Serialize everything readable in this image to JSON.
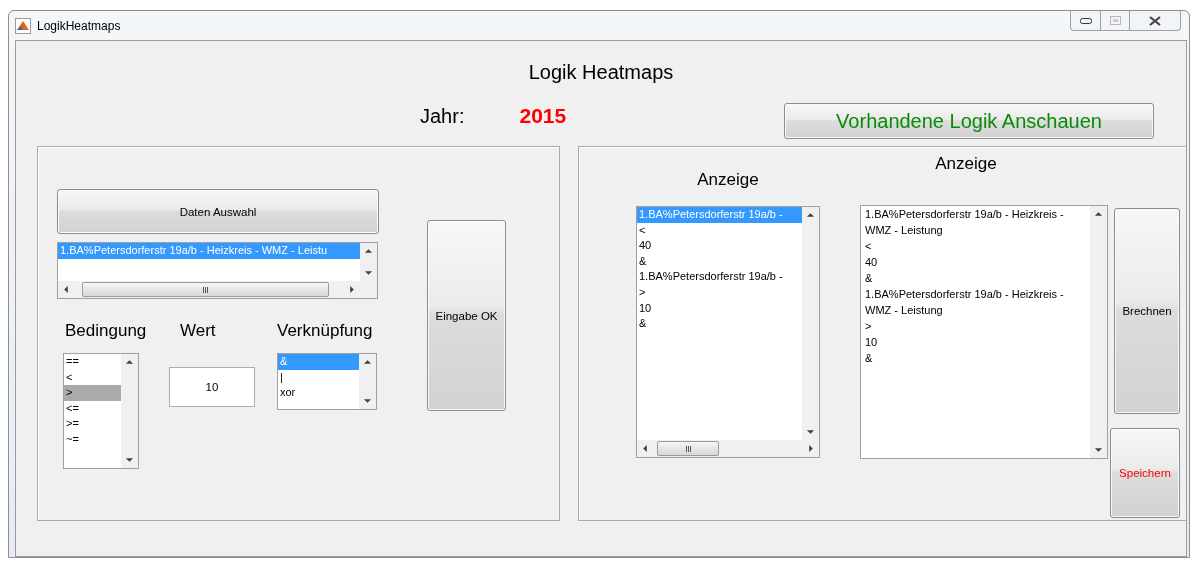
{
  "window": {
    "title": "LogikHeatmaps"
  },
  "heading": "Logik Heatmaps",
  "year_label": "Jahr:",
  "year": "2015",
  "show_button": "Vorhandene Logik Anschauen",
  "left_panel": {
    "data_button": "Daten Auswahl",
    "data_list": {
      "focused": true,
      "items": [
        {
          "text": "1.BA%Petersdorferstr 19a/b - Heizkreis - WMZ - Leistu",
          "selected": true
        }
      ]
    },
    "condition": {
      "label": "Bedingung",
      "focused": false,
      "items": [
        {
          "text": "==",
          "selected": false
        },
        {
          "text": "<",
          "selected": false
        },
        {
          "text": ">",
          "selected": true
        },
        {
          "text": "<=",
          "selected": false
        },
        {
          "text": ">=",
          "selected": false
        },
        {
          "text": "~=",
          "selected": false
        }
      ]
    },
    "value": {
      "label": "Wert",
      "value": "10"
    },
    "link": {
      "label": "Verknüpfung",
      "focused": true,
      "items": [
        {
          "text": "&",
          "selected": true
        },
        {
          "text": "|",
          "selected": false
        },
        {
          "text": "xor",
          "selected": false
        }
      ]
    },
    "ok_button": "Eingabe OK"
  },
  "right_panel": {
    "title": "Anzeige",
    "list_title": "Anzeige",
    "list": {
      "focused": true,
      "items": [
        {
          "text": "1.BA%Petersdorferstr 19a/b -",
          "selected": true
        },
        {
          "text": "<",
          "selected": false
        },
        {
          "text": "40",
          "selected": false
        },
        {
          "text": "&",
          "selected": false
        },
        {
          "text": "1.BA%Petersdorferstr 19a/b -",
          "selected": false
        },
        {
          "text": ">",
          "selected": false
        },
        {
          "text": "10",
          "selected": false
        },
        {
          "text": "&",
          "selected": false
        }
      ]
    },
    "output_list": {
      "items": [
        {
          "text": "1.BA%Petersdorferstr 19a/b - Heizkreis - WMZ - Leistung",
          "selected": false
        },
        {
          "text": "<",
          "selected": false
        },
        {
          "text": "40",
          "selected": false
        },
        {
          "text": "&",
          "selected": false
        },
        {
          "text": "1.BA%Petersdorferstr 19a/b - Heizkreis - WMZ - Leistung",
          "selected": false
        },
        {
          "text": ">",
          "selected": false
        },
        {
          "text": "10",
          "selected": false
        },
        {
          "text": "&",
          "selected": false
        }
      ]
    },
    "calc_button": "Brechnen",
    "save_button": "Speichern"
  }
}
